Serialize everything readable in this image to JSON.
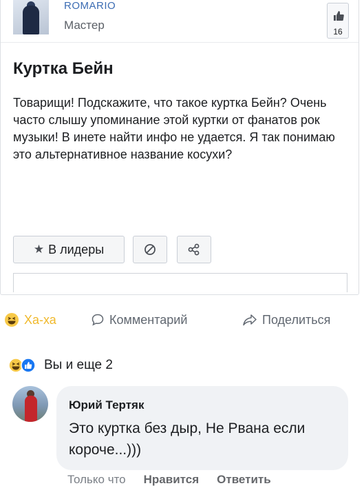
{
  "post": {
    "author_name": "ROMARIO",
    "author_rank": "Мастер",
    "like_count": "16",
    "title": "Куртка Бейн",
    "body": "Товарищи! Подскажите, что такое куртка Бейн? Очень часто слышу упоминание этой куртки от фанатов рок музыки! В инете найти инфо не удается. Я так понимаю это альтернативное название косухи?",
    "buttons": {
      "leaders_label": "В лидеры",
      "leaders_icon": "star-icon",
      "block_icon": "block-icon",
      "share_icon": "share-icon"
    }
  },
  "actions": {
    "haha_label": "Ха-ха",
    "comment_label": "Комментарий",
    "share_label": "Поделиться",
    "haha_color": "#f0b92c",
    "muted_color": "#606770"
  },
  "reactions": {
    "label": "Вы и еще 2",
    "icons": [
      "haha-icon",
      "like-icon"
    ]
  },
  "comment": {
    "author": "Юрий Тертяк",
    "text": "Это куртка без дыр, Не Рвана если короче...)))",
    "time": "Только что",
    "like_label": "Нравится",
    "reply_label": "Ответить"
  }
}
